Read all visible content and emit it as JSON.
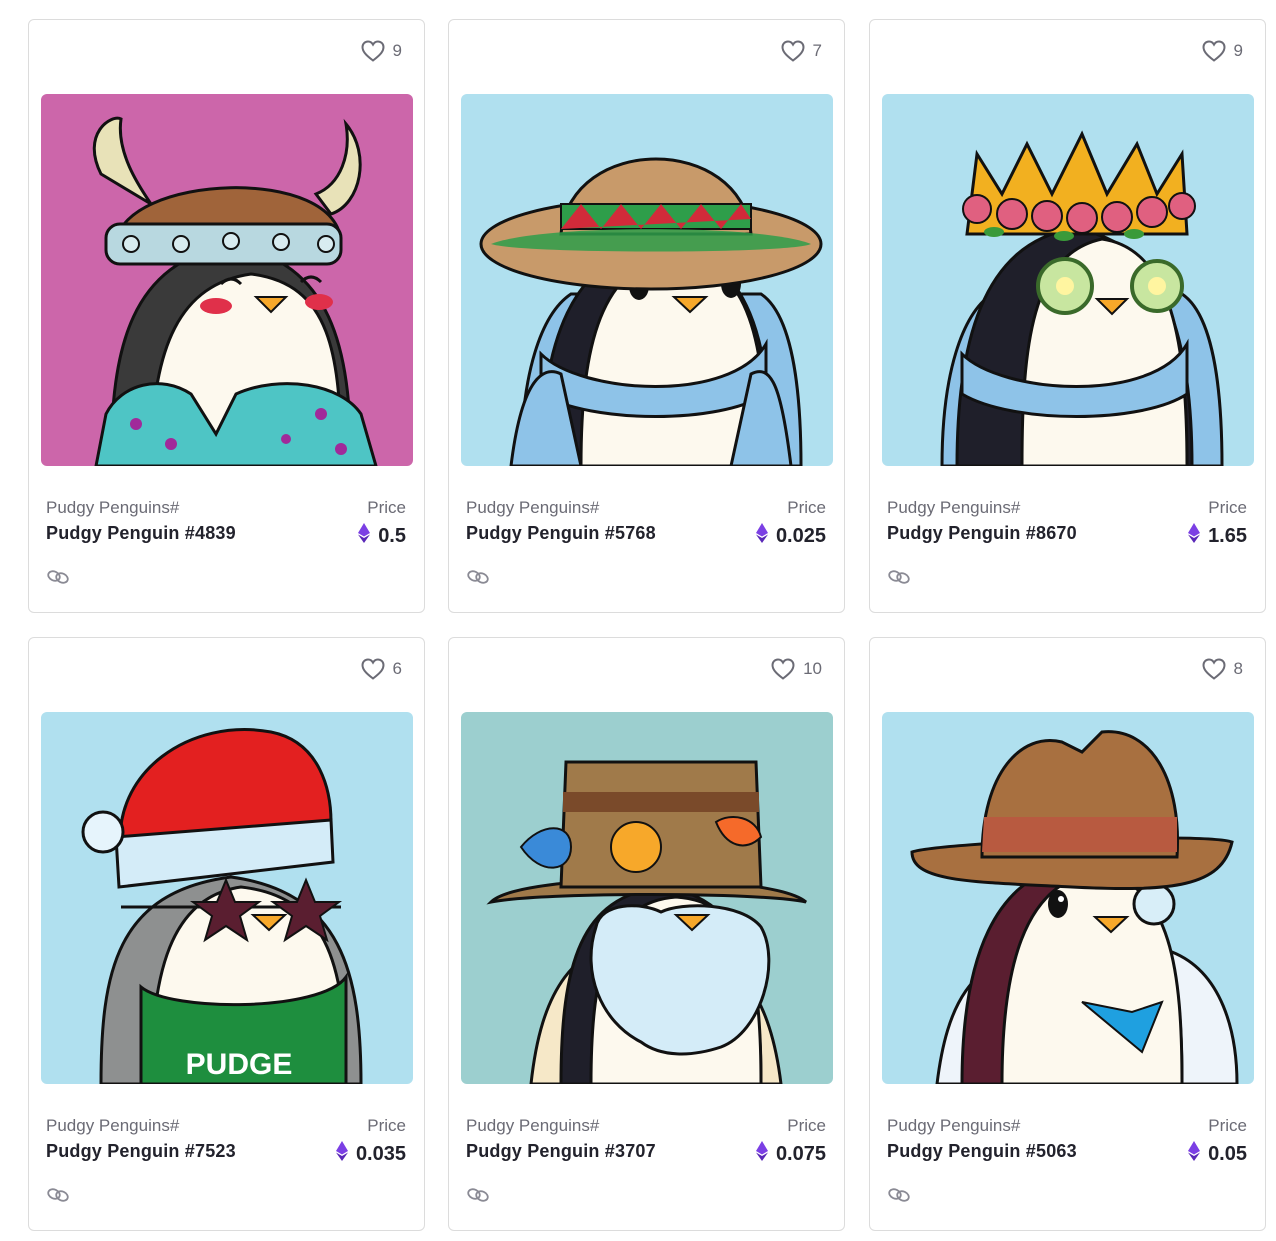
{
  "colors": {
    "card_border": "#dcdcdc",
    "muted_text": "#6b6b75",
    "eth_purple": "#7b3fe4"
  },
  "icons": {
    "like": "heart-outline-icon",
    "currency": "ethereum-icon",
    "link": "chain-link-icon"
  },
  "cards": [
    {
      "likes": "9",
      "collection": "Pudgy Penguins#",
      "name": "Pudgy Penguin #4839",
      "price_label": "Price",
      "price": "0.5",
      "art": {
        "bg": "#cc66aa",
        "trait": "viking helmet, hawaiian shirt"
      }
    },
    {
      "likes": "7",
      "collection": "Pudgy Penguins#",
      "name": "Pudgy Penguin #5768",
      "price_label": "Price",
      "price": "0.025",
      "art": {
        "bg": "#b0e0ef",
        "trait": "sombrero, blue sweater"
      }
    },
    {
      "likes": "9",
      "collection": "Pudgy Penguins#",
      "name": "Pudgy Penguin #8670",
      "price_label": "Price",
      "price": "1.65",
      "art": {
        "bg": "#b0e0ef",
        "trait": "flower crown, cucumber eyes, blue sweater"
      }
    },
    {
      "likes": "6",
      "collection": "Pudgy Penguins#",
      "name": "Pudgy Penguin #7523",
      "price_label": "Price",
      "price": "0.035",
      "art": {
        "bg": "#b0e0ef",
        "trait": "santa hat, star glasses, green apron",
        "apron_text": "PUDGE"
      }
    },
    {
      "likes": "10",
      "collection": "Pudgy Penguins#",
      "name": "Pudgy Penguin #3707",
      "price_label": "Price",
      "price": "0.075",
      "art": {
        "bg": "#9ccfcf",
        "trait": "fishing hat, beard, robe"
      }
    },
    {
      "likes": "8",
      "collection": "Pudgy Penguins#",
      "name": "Pudgy Penguin #5063",
      "price_label": "Price",
      "price": "0.05",
      "art": {
        "bg": "#b0e0ef",
        "trait": "cowboy hat, monocle, lab coat"
      }
    }
  ]
}
